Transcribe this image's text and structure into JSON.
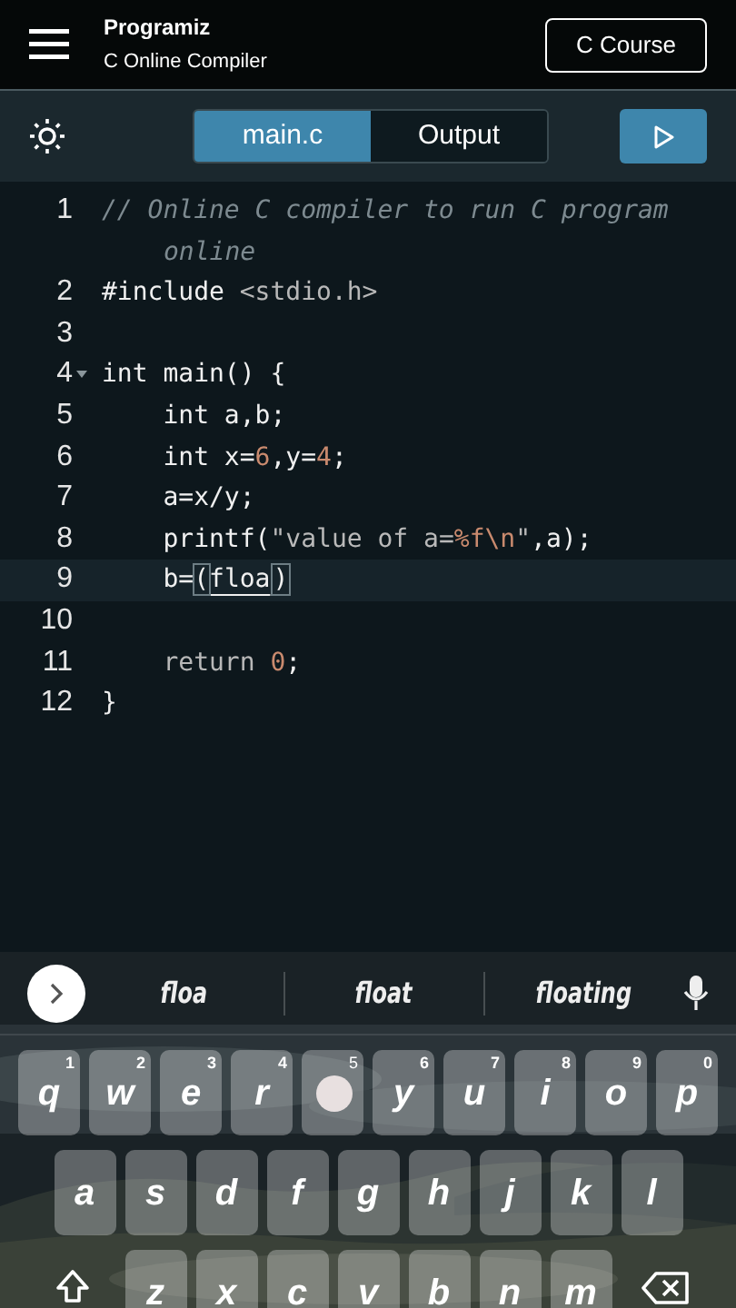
{
  "header": {
    "logo": "Programiz",
    "subtitle": "C Online Compiler",
    "course_button": "C Course"
  },
  "tabs": [
    {
      "label": "main.c",
      "selected": true
    },
    {
      "label": "Output",
      "selected": false
    }
  ],
  "code": [
    {
      "number": "1",
      "fold": false,
      "current": false,
      "tokens": [
        {
          "kind": "comment",
          "text": "// Online C compiler to run C program online"
        }
      ]
    },
    {
      "number": "2",
      "fold": false,
      "current": false,
      "tokens": [
        {
          "kind": "plain",
          "text": "#include "
        },
        {
          "kind": "dim",
          "text": "<stdio.h>"
        }
      ]
    },
    {
      "number": "3",
      "fold": false,
      "current": false
    },
    {
      "number": "4",
      "fold": true,
      "current": false,
      "tokens": [
        {
          "kind": "plain",
          "text": "int main() {"
        }
      ]
    },
    {
      "number": "5",
      "fold": false,
      "current": false,
      "tokens": [
        {
          "kind": "plain",
          "text": "    int a,b;"
        }
      ]
    },
    {
      "number": "6",
      "fold": false,
      "current": false,
      "tokens": [
        {
          "kind": "plain",
          "text": "    int x="
        },
        {
          "kind": "number",
          "text": "6"
        },
        {
          "kind": "plain",
          "text": ",y="
        },
        {
          "kind": "number",
          "text": "4"
        },
        {
          "kind": "plain",
          "text": ";"
        }
      ]
    },
    {
      "number": "7",
      "fold": false,
      "current": false,
      "tokens": [
        {
          "kind": "plain",
          "text": "    a=x/y;"
        }
      ]
    },
    {
      "number": "8",
      "fold": false,
      "current": false,
      "tokens": [
        {
          "kind": "plain",
          "text": "    printf("
        },
        {
          "kind": "string",
          "text": "\"value of a="
        },
        {
          "kind": "number",
          "text": "%f\\n"
        },
        {
          "kind": "string",
          "text": "\""
        },
        {
          "kind": "plain",
          "text": ",a);"
        }
      ]
    },
    {
      "number": "9",
      "fold": false,
      "current": true,
      "tokens": [
        {
          "kind": "plain",
          "text": "    b="
        },
        {
          "kind": "bracket",
          "text": "("
        },
        {
          "kind": "composing",
          "text": "floa"
        },
        {
          "kind": "bracket",
          "text": ")"
        }
      ]
    },
    {
      "number": "10",
      "fold": false,
      "current": false
    },
    {
      "number": "11",
      "fold": false,
      "current": false,
      "tokens": [
        {
          "kind": "dim",
          "text": "    return "
        },
        {
          "kind": "number",
          "text": "0"
        },
        {
          "kind": "plain",
          "text": ";"
        }
      ]
    },
    {
      "number": "12",
      "fold": false,
      "current": false,
      "tokens": [
        {
          "kind": "plain",
          "text": "}"
        }
      ]
    }
  ],
  "keyboard": {
    "suggestions": [
      "floa",
      "float",
      "floating"
    ],
    "rows": [
      [
        {
          "kind": "letter",
          "label": "q",
          "hint": "1",
          "pressed": false
        },
        {
          "kind": "letter",
          "label": "w",
          "hint": "2",
          "pressed": false
        },
        {
          "kind": "letter",
          "label": "e",
          "hint": "3",
          "pressed": false
        },
        {
          "kind": "letter",
          "label": "r",
          "hint": "4",
          "pressed": false
        },
        {
          "kind": "letter",
          "hint": "5",
          "pressed": true
        },
        {
          "kind": "letter",
          "label": "y",
          "hint": "6",
          "pressed": false
        },
        {
          "kind": "letter",
          "label": "u",
          "hint": "7",
          "pressed": false
        },
        {
          "kind": "letter",
          "label": "i",
          "hint": "8",
          "pressed": false
        },
        {
          "kind": "letter",
          "label": "o",
          "hint": "9",
          "pressed": false
        },
        {
          "kind": "letter",
          "label": "p",
          "hint": "0",
          "pressed": false
        }
      ],
      [
        {
          "kind": "letter",
          "label": "a",
          "pressed": false
        },
        {
          "kind": "letter",
          "label": "s",
          "pressed": false
        },
        {
          "kind": "letter",
          "label": "d",
          "pressed": false
        },
        {
          "kind": "letter",
          "label": "f",
          "pressed": false
        },
        {
          "kind": "letter",
          "label": "g",
          "pressed": false
        },
        {
          "kind": "letter",
          "label": "h",
          "pressed": false
        },
        {
          "kind": "letter",
          "label": "j",
          "pressed": false
        },
        {
          "kind": "letter",
          "label": "k",
          "pressed": false
        },
        {
          "kind": "letter",
          "label": "l",
          "pressed": false
        }
      ],
      [
        {
          "kind": "shift"
        },
        {
          "kind": "letter",
          "label": "z",
          "pressed": false
        },
        {
          "kind": "letter",
          "label": "x",
          "pressed": false
        },
        {
          "kind": "letter",
          "label": "c",
          "pressed": false
        },
        {
          "kind": "letter",
          "label": "v",
          "pressed": false
        },
        {
          "kind": "letter",
          "label": "b",
          "pressed": false
        },
        {
          "kind": "letter",
          "label": "n",
          "pressed": false
        },
        {
          "kind": "letter",
          "label": "m",
          "pressed": false
        },
        {
          "kind": "backspace"
        }
      ]
    ]
  }
}
